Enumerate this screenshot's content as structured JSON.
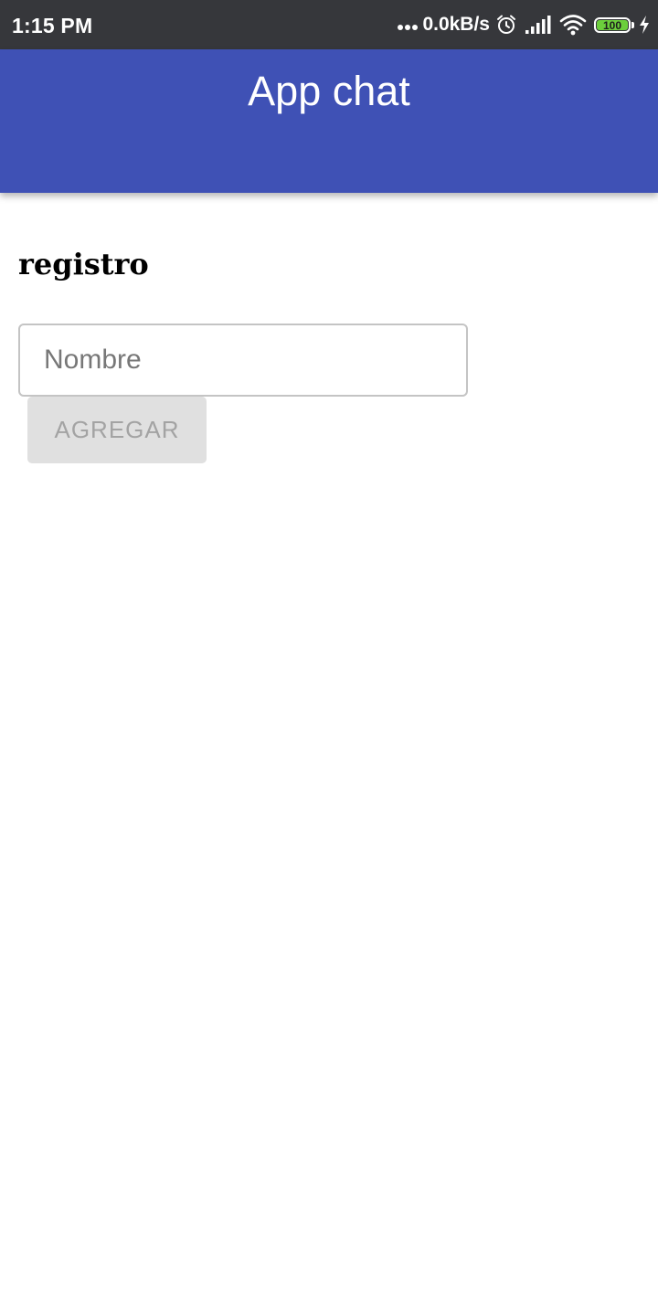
{
  "status_bar": {
    "time": "1:15 PM",
    "net_speed": "0.0kB/s",
    "battery_level": "100",
    "icons": [
      "alarm-icon",
      "signal-icon",
      "wifi-icon",
      "battery-icon",
      "charging-icon"
    ]
  },
  "app_bar": {
    "title": "App chat",
    "color": "#3f51b5"
  },
  "form": {
    "heading": "registro",
    "name_placeholder": "Nombre",
    "name_value": "",
    "add_button_label": "AGREGAR"
  },
  "colors": {
    "status_bar": "#36373b",
    "app_bar": "#3f51b5",
    "battery": "#6ccf3c",
    "button_disabled_bg": "#e0e0e0",
    "button_disabled_text": "#a3a3a3"
  }
}
